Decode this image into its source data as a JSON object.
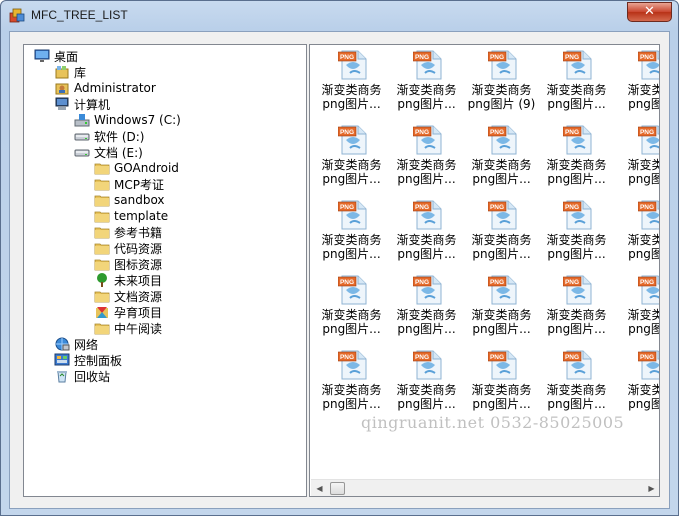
{
  "window": {
    "title": "MFC_TREE_LIST",
    "close_label": "✕"
  },
  "tree": {
    "items": [
      {
        "label": "桌面",
        "icon": "desktop-icon",
        "level": 0
      },
      {
        "label": "库",
        "icon": "library-icon",
        "level": 1
      },
      {
        "label": "Administrator",
        "icon": "user-folder-icon",
        "level": 1
      },
      {
        "label": "计算机",
        "icon": "computer-icon",
        "level": 1
      },
      {
        "label": "Windows7 (C:)",
        "icon": "system-drive-icon",
        "level": 2
      },
      {
        "label": "软件 (D:)",
        "icon": "drive-icon",
        "level": 2
      },
      {
        "label": "文档 (E:)",
        "icon": "drive-icon",
        "level": 2
      },
      {
        "label": "GOAndroid",
        "icon": "folder-icon",
        "level": 3
      },
      {
        "label": "MCP考证",
        "icon": "folder-icon",
        "level": 3
      },
      {
        "label": "sandbox",
        "icon": "folder-icon",
        "level": 3
      },
      {
        "label": "template",
        "icon": "folder-icon",
        "level": 3
      },
      {
        "label": "参考书籍",
        "icon": "folder-icon",
        "level": 3
      },
      {
        "label": "代码资源",
        "icon": "folder-icon",
        "level": 3
      },
      {
        "label": "图标资源",
        "icon": "folder-icon",
        "level": 3
      },
      {
        "label": "未来项目",
        "icon": "tree-folder-icon",
        "level": 3
      },
      {
        "label": "文档资源",
        "icon": "folder-icon",
        "level": 3
      },
      {
        "label": "孕育项目",
        "icon": "colorful-folder-icon",
        "level": 3
      },
      {
        "label": "中午阅读",
        "icon": "folder-icon",
        "level": 3
      },
      {
        "label": "网络",
        "icon": "network-icon",
        "level": 1
      },
      {
        "label": "控制面板",
        "icon": "control-panel-icon",
        "level": 1
      },
      {
        "label": "回收站",
        "icon": "recycle-bin-icon",
        "level": 1
      }
    ]
  },
  "list": {
    "icon_badge": "PNG",
    "rows": [
      [
        {
          "line1": "渐变类商务",
          "line2": "png图片..."
        },
        {
          "line1": "渐变类商务",
          "line2": "png图片..."
        },
        {
          "line1": "渐变类商务",
          "line2": "png图片 (9)"
        },
        {
          "line1": "渐变类商务",
          "line2": "png图片..."
        },
        {
          "line1": "渐变类商",
          "line2": "png图片"
        }
      ],
      [
        {
          "line1": "渐变类商务",
          "line2": "png图片..."
        },
        {
          "line1": "渐变类商务",
          "line2": "png图片..."
        },
        {
          "line1": "渐变类商务",
          "line2": "png图片..."
        },
        {
          "line1": "渐变类商务",
          "line2": "png图片..."
        },
        {
          "line1": "渐变类商",
          "line2": "png图片"
        }
      ],
      [
        {
          "line1": "渐变类商务",
          "line2": "png图片..."
        },
        {
          "line1": "渐变类商务",
          "line2": "png图片..."
        },
        {
          "line1": "渐变类商务",
          "line2": "png图片..."
        },
        {
          "line1": "渐变类商务",
          "line2": "png图片..."
        },
        {
          "line1": "渐变类商",
          "line2": "png图片"
        }
      ],
      [
        {
          "line1": "渐变类商务",
          "line2": "png图片..."
        },
        {
          "line1": "渐变类商务",
          "line2": "png图片..."
        },
        {
          "line1": "渐变类商务",
          "line2": "png图片..."
        },
        {
          "line1": "渐变类商务",
          "line2": "png图片..."
        },
        {
          "line1": "渐变类商",
          "line2": "png图片"
        }
      ],
      [
        {
          "line1": "渐变类商务",
          "line2": "png图片..."
        },
        {
          "line1": "渐变类商务",
          "line2": "png图片..."
        },
        {
          "line1": "渐变类商务",
          "line2": "png图片..."
        },
        {
          "line1": "渐变类商务",
          "line2": "png图片..."
        },
        {
          "line1": "渐变类商",
          "line2": "png图片"
        }
      ]
    ]
  },
  "scrollbar": {
    "left_arrow": "◀",
    "right_arrow": "▶"
  },
  "watermark": "qingruanit.net 0532-85025005"
}
